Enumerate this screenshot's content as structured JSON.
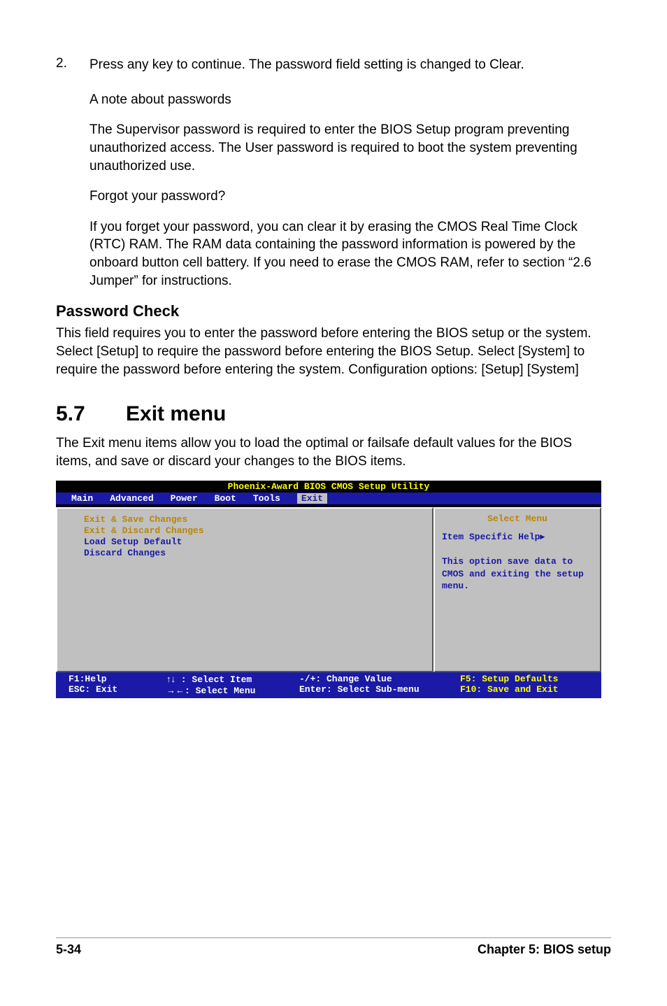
{
  "step": {
    "num": "2.",
    "text": "Press any key to continue. The password field setting is changed to Clear."
  },
  "note_heading": "A note about passwords",
  "note_p1": "The Supervisor password is required to enter the BIOS Setup program preventing unauthorized access. The User password is required to boot the system preventing unauthorized use.",
  "forgot_heading": "Forgot your password?",
  "forgot_p": "If you forget your password, you can clear it by erasing the CMOS Real Time Clock (RTC) RAM. The RAM data containing the password information is powered by the onboard button cell battery. If you need to erase the CMOS RAM, refer to section “2.6 Jumper” for instructions.",
  "pwcheck_heading": "Password Check",
  "pwcheck_body": "This field requires you to enter the password before entering the BIOS setup or the system. Select [Setup] to require the password before entering the BIOS Setup. Select [System] to require the password before entering the system. Configuration options: [Setup] [System]",
  "section_num": "5.7",
  "section_title": "Exit menu",
  "section_intro": "The Exit menu items allow you to load the optimal or failsafe default values for the BIOS items, and save or discard your changes to the BIOS items.",
  "bios": {
    "title": "Phoenix-Award BIOS CMOS Setup Utility",
    "tabs": [
      "Main",
      "Advanced",
      "Power",
      "Boot",
      "Tools",
      "Exit"
    ],
    "selected_tab": "Exit",
    "left_items": [
      "Exit & Save Changes",
      "Exit & Discard Changes",
      "Load Setup Default",
      "Discard Changes"
    ],
    "right_title": "Select Menu",
    "right_help_label": "Item Specific Help",
    "right_help_text": "This option save data to CMOS and exiting the setup menu.",
    "footer": {
      "f1": "F1:Help",
      "esc": "ESC: Exit",
      "sel_item": " : Select Item",
      "sel_menu": ": Select Menu",
      "change": "-/+: Change Value",
      "enter": "Enter: Select Sub-menu",
      "f5": "F5: Setup Defaults",
      "f10": "F10: Save and Exit"
    }
  },
  "footer_left": "5-34",
  "footer_right": "Chapter 5: BIOS setup"
}
